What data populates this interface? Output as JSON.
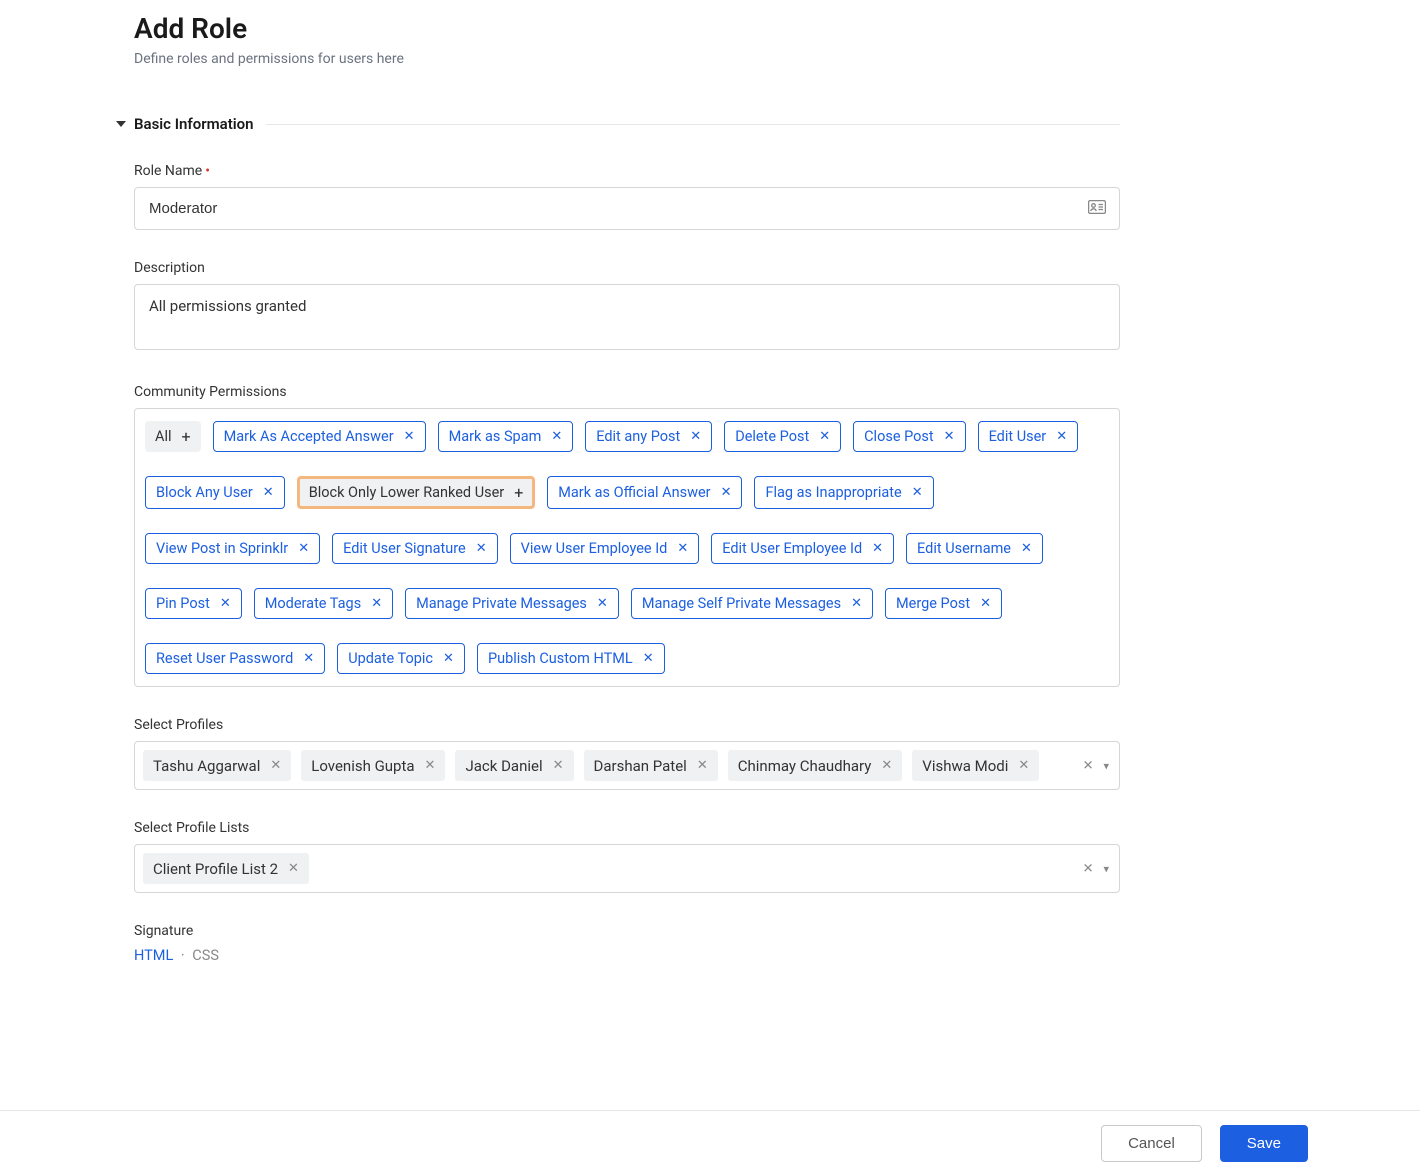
{
  "header": {
    "title": "Add Role",
    "subtitle": "Define roles and permissions for users here"
  },
  "section": {
    "basic_info": "Basic Information"
  },
  "fields": {
    "role_name_label": "Role Name",
    "role_name_value": "Moderator",
    "description_label": "Description",
    "description_value": "All permissions granted",
    "community_permissions_label": "Community Permissions",
    "select_profiles_label": "Select Profiles",
    "select_profile_lists_label": "Select Profile Lists",
    "signature_label": "Signature"
  },
  "permissions": {
    "all_label": "All",
    "items": [
      "Mark As Accepted Answer",
      "Mark as Spam",
      "Edit any Post",
      "Delete Post",
      "Close Post",
      "Edit User",
      "Block Any User"
    ],
    "highlighted": "Block Only Lower Ranked User",
    "items2": [
      "Mark as Official Answer",
      "Flag as Inappropriate",
      "View Post in Sprinklr",
      "Edit User Signature",
      "View User Employee Id",
      "Edit User Employee Id",
      "Edit Username",
      "Pin Post",
      "Moderate Tags",
      "Manage Private Messages",
      "Manage Self Private Messages",
      "Merge Post",
      "Reset User Password",
      "Update Topic",
      "Publish Custom HTML"
    ]
  },
  "profiles": [
    "Tashu Aggarwal",
    "Lovenish Gupta",
    "Jack Daniel",
    "Darshan Patel",
    "Chinmay Chaudhary",
    "Vishwa Modi"
  ],
  "profile_lists": [
    "Client Profile List 2"
  ],
  "signature_tabs": {
    "html": "HTML",
    "css": "CSS"
  },
  "footer": {
    "cancel": "Cancel",
    "save": "Save"
  }
}
